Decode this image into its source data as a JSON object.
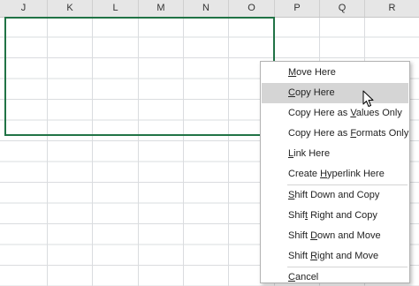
{
  "spreadsheet": {
    "columns": [
      "J",
      "K",
      "L",
      "M",
      "N",
      "O",
      "P",
      "Q",
      "R"
    ]
  },
  "context_menu": {
    "items": [
      {
        "pre": "",
        "ul": "M",
        "post": "ove Here"
      },
      {
        "pre": "",
        "ul": "C",
        "post": "opy Here"
      },
      {
        "pre": "Copy Here as ",
        "ul": "V",
        "post": "alues Only"
      },
      {
        "pre": "Copy Here as ",
        "ul": "F",
        "post": "ormats Only"
      },
      {
        "pre": "",
        "ul": "L",
        "post": "ink Here"
      },
      {
        "pre": "Create ",
        "ul": "H",
        "post": "yperlink Here"
      },
      {
        "pre": "",
        "ul": "S",
        "post": "hift Down and Copy"
      },
      {
        "pre": "Shif",
        "ul": "t",
        "post": " Right and Copy"
      },
      {
        "pre": "Shift ",
        "ul": "D",
        "post": "own and Move"
      },
      {
        "pre": "Shift ",
        "ul": "R",
        "post": "ight and Move"
      },
      {
        "pre": "",
        "ul": "C",
        "post": "ancel"
      }
    ]
  },
  "colors": {
    "selection_border": "#217346",
    "menu_highlight": "#d5d5d5"
  },
  "cursor_icon": "arrow-cursor-icon"
}
